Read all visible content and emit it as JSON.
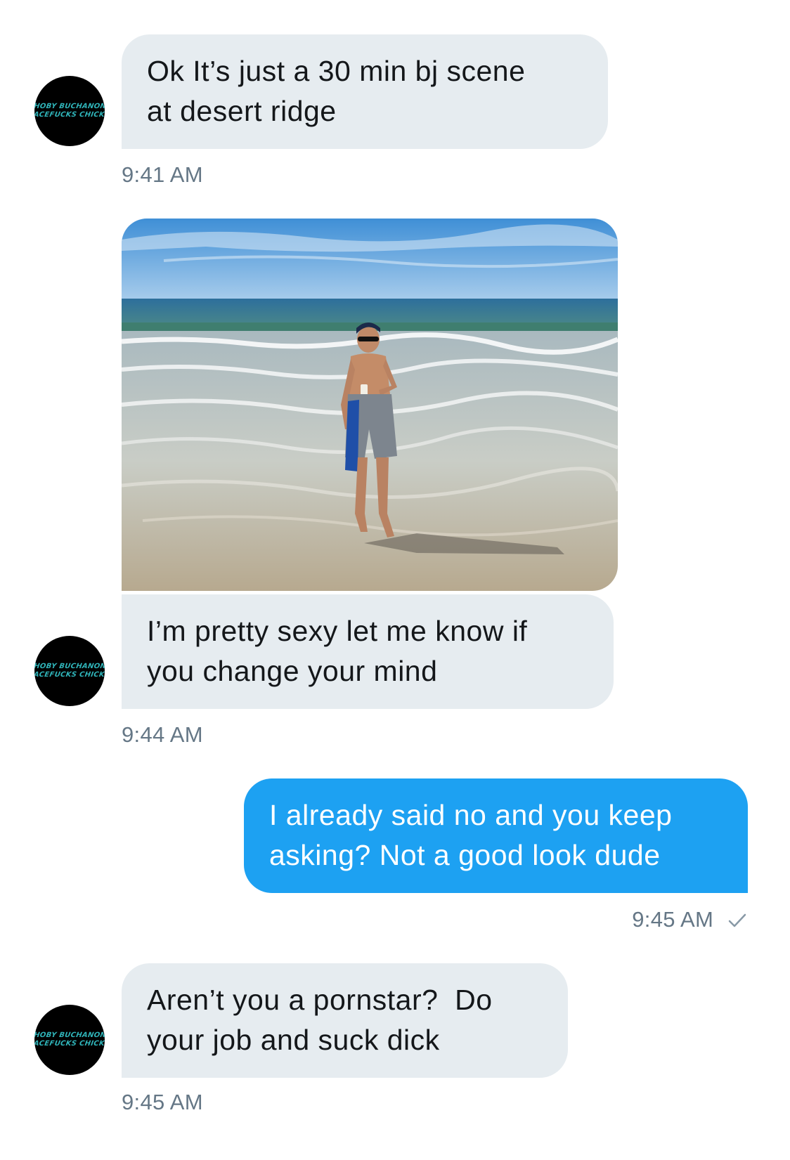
{
  "contact": {
    "avatar_lines": [
      "HOBY BUCHANON",
      "FACEFUCKS CHICKS"
    ]
  },
  "messages": [
    {
      "direction": "incoming",
      "lines": [
        "Ok It’s just a 30 min bj scene",
        "at desert ridge"
      ],
      "time": "9:41 AM"
    },
    {
      "direction": "incoming",
      "attachment": "photo of shirtless man standing in the ocean surf holding a cup",
      "lines": [
        "I’m pretty sexy let me know if",
        "you change your mind"
      ],
      "time": "9:44 AM"
    },
    {
      "direction": "outgoing",
      "lines": [
        "I already said no and you keep",
        "asking? Not a good look dude"
      ],
      "time": "9:45 AM",
      "status_icon": "checkmark-icon"
    },
    {
      "direction": "incoming",
      "lines": [
        "Aren’t you a pornstar?  Do",
        "your job and suck dick"
      ],
      "time": "9:45 AM"
    }
  ],
  "colors": {
    "incoming_bubble": "#e6ecf0",
    "outgoing_bubble": "#1da1f2",
    "timestamp": "#657786",
    "avatar_text": "#2fb3b8"
  }
}
